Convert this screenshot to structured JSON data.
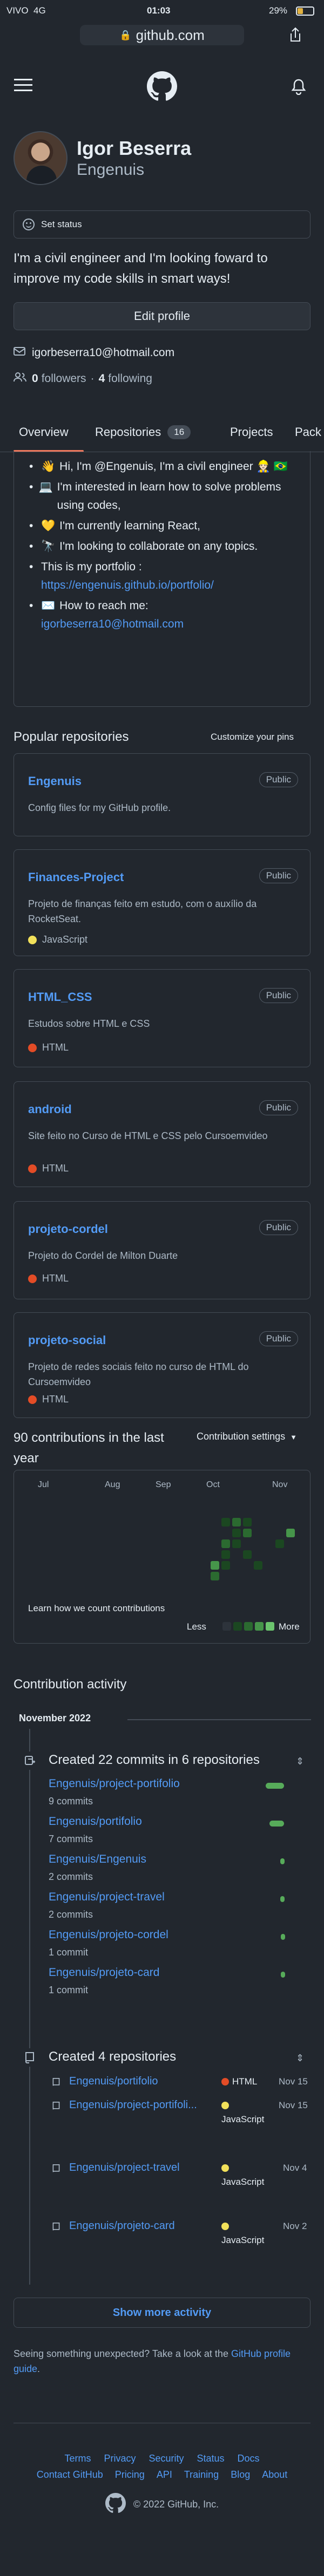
{
  "status_bar": {
    "carrier": "VIVO",
    "network": "4G",
    "time": "01:03",
    "battery": "29%"
  },
  "browser": {
    "url": "github.com"
  },
  "profile": {
    "name": "Igor Beserra",
    "username": "Engenuis",
    "set_status": "Set status",
    "bio": "I'm a civil engineer and I'm looking foward to improve my code skills in smart ways!",
    "edit_profile": "Edit profile",
    "email": "igorbeserra10@hotmail.com",
    "followers_count": "0",
    "followers_label": "followers",
    "separator": "·",
    "following_count": "4",
    "following_label": "following"
  },
  "tabs": [
    {
      "label": "Overview",
      "selected": true
    },
    {
      "label": "Repositories",
      "count": "16"
    },
    {
      "label": "Projects"
    },
    {
      "label": "Pack"
    }
  ],
  "readme": [
    {
      "icon": "👋",
      "text": "Hi, I'm @Engenuis, I'm a civil engineer 👷🏻 🇧🇷"
    },
    {
      "icon": "💻",
      "text": "I'm interested in learn how to solve problems using codes,"
    },
    {
      "icon": "💛",
      "text": "I'm currently learning React,"
    },
    {
      "icon": "🔭",
      "text": "I'm looking to collaborate on any topics."
    },
    {
      "icon": "",
      "text": "This is my portfolio :",
      "link": "https://engenuis.github.io/portfolio/"
    },
    {
      "icon": "✉️",
      "text": "How to reach me:",
      "link": "igorbeserra10@hotmail.com"
    }
  ],
  "popular": {
    "title": "Popular repositories",
    "customize": "Customize your pins",
    "repos": [
      {
        "name": "Engenuis",
        "visibility": "Public",
        "description": "Config files for my GitHub profile.",
        "language": "",
        "lang_color": ""
      },
      {
        "name": "Finances-Project",
        "visibility": "Public",
        "description": "Projeto de finanças feito em estudo, com o auxílio da RocketSeat.",
        "language": "JavaScript",
        "lang_color": "#f1e05a"
      },
      {
        "name": "HTML_CSS",
        "visibility": "Public",
        "description": "Estudos sobre HTML e CSS",
        "language": "HTML",
        "lang_color": "#e34c26"
      },
      {
        "name": "android",
        "visibility": "Public",
        "description": "Site feito no Curso de HTML e CSS pelo Cursoemvideo",
        "language": "HTML",
        "lang_color": "#e34c26"
      },
      {
        "name": "projeto-cordel",
        "visibility": "Public",
        "description": "Projeto do Cordel de Milton Duarte",
        "language": "HTML",
        "lang_color": "#e34c26"
      },
      {
        "name": "projeto-social",
        "visibility": "Public",
        "description": "Projeto de redes sociais feito no curso de HTML do Cursoemvideo",
        "language": "HTML",
        "lang_color": "#e34c26"
      }
    ]
  },
  "contributions": {
    "title": "90 contributions in the last year",
    "settings": "Contribution settings",
    "months": [
      "Jul",
      "Aug",
      "Sep",
      "Oct",
      "Nov"
    ],
    "learn": "Learn how we count contributions",
    "less": "Less",
    "more": "More"
  },
  "activity": {
    "title": "Contribution activity",
    "month": "November 2022",
    "commits_summary": "Created 22 commits in 6 repositories",
    "commits": [
      {
        "repo": "Engenuis/project-portifolio",
        "count": "9 commits",
        "fraction": 1.0
      },
      {
        "repo": "Engenuis/portifolio",
        "count": "7 commits",
        "fraction": 0.78
      },
      {
        "repo": "Engenuis/Engenuis",
        "count": "2 commits",
        "fraction": 0.22
      },
      {
        "repo": "Engenuis/project-travel",
        "count": "2 commits",
        "fraction": 0.22
      },
      {
        "repo": "Engenuis/projeto-cordel",
        "count": "1 commit",
        "fraction": 0.11
      },
      {
        "repo": "Engenuis/projeto-card",
        "count": "1 commit",
        "fraction": 0.11
      }
    ],
    "repos_summary": "Created 4 repositories",
    "created": [
      {
        "repo": "Engenuis/portifolio",
        "language": "HTML",
        "lang_color": "#e34c26",
        "date": "Nov 15"
      },
      {
        "repo": "Engenuis/project-portifoli...",
        "language": "JavaScript",
        "lang_color": "#f1e05a",
        "date": "Nov 15"
      },
      {
        "repo": "Engenuis/project-travel",
        "language": "JavaScript",
        "lang_color": "#f1e05a",
        "date": "Nov 4"
      },
      {
        "repo": "Engenuis/projeto-card",
        "language": "JavaScript",
        "lang_color": "#f1e05a",
        "date": "Nov 2"
      }
    ],
    "show_more": "Show more activity",
    "unexpected_prefix": "Seeing something unexpected? Take a look at the ",
    "unexpected_link": "GitHub profile guide",
    "unexpected_suffix": "."
  },
  "footer": {
    "links_row1": [
      "Terms",
      "Privacy",
      "Security",
      "Status",
      "Docs"
    ],
    "links_row2": [
      "Contact GitHub",
      "Pricing",
      "API",
      "Training",
      "Blog",
      "About"
    ],
    "copyright": "© 2022 GitHub, Inc."
  },
  "colors": {
    "accent": "#539bf5",
    "green": "#57ab5a",
    "tab_underline": "#ec775c"
  }
}
